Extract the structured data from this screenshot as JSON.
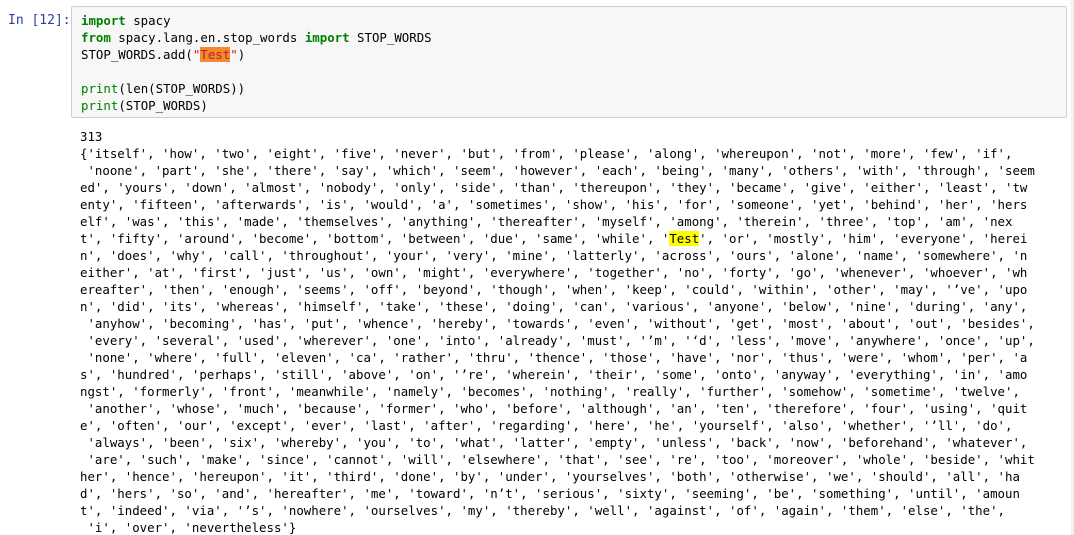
{
  "cell": {
    "prompt": "In [12]:",
    "code": {
      "line1": {
        "kw": "import",
        "rest": " spacy"
      },
      "line2": {
        "kw1": "from",
        "mod": " spacy.lang.en.stop_words ",
        "kw2": "import",
        "rest": " STOP_WORDS"
      },
      "line3": {
        "pre": "STOP_WORDS.add(",
        "q1": "\"",
        "hl": "Test",
        "q2": "\"",
        "post": ")"
      },
      "line5": {
        "fn": "print",
        "rest": "(len(STOP_WORDS))"
      },
      "line6": {
        "fn": "print",
        "rest": "(STOP_WORDS)"
      }
    }
  },
  "output": {
    "count": "313",
    "lines": [
      "{'itself', 'how', 'two', 'eight', 'five', 'never', 'but', 'from', 'please', 'along', 'whereupon', 'not', 'more', 'few', 'if',",
      " 'noone', 'part', 'she', 'there', 'say', 'which', 'seem', 'however', 'each', 'being', 'many', 'others', 'with', 'through', 'seem",
      "ed', 'yours', 'down', 'almost', 'nobody', 'only', 'side', 'than', 'thereupon', 'they', 'became', 'give', 'either', 'least', 'tw",
      "enty', 'fifteen', 'afterwards', 'is', 'would', 'a', 'sometimes', 'show', 'his', 'for', 'someone', 'yet', 'behind', 'her', 'hers",
      "elf', 'was', 'this', 'made', 'themselves', 'anything', 'thereafter', 'myself', 'among', 'therein', 'three', 'top', 'am', 'nex",
      {
        "before": "t', 'fifty', 'around', 'become', 'bottom', 'between', 'due', 'same', 'while', '",
        "highlight": "Test",
        "after": "', 'or', 'mostly', 'him', 'everyone', 'herei"
      },
      "n', 'does', 'why', 'call', 'throughout', 'your', 'very', 'mine', 'latterly', 'across', 'ours', 'alone', 'name', 'somewhere', 'n",
      "either', 'at', 'first', 'just', 'us', 'own', 'might', 'everywhere', 'together', 'no', 'forty', 'go', 'whenever', 'whoever', 'wh",
      "ereafter', 'then', 'enough', 'seems', 'off', 'beyond', 'though', 'when', 'keep', 'could', 'within', 'other', 'may', '’ve', 'upo",
      "n', 'did', 'its', 'whereas', 'himself', 'take', 'these', 'doing', 'can', 'various', 'anyone', 'below', 'nine', 'during', 'any',",
      " 'anyhow', 'becoming', 'has', 'put', 'whence', 'hereby', 'towards', 'even', 'without', 'get', 'most', 'about', 'out', 'besides',",
      " 'every', 'several', 'used', 'wherever', 'one', 'into', 'already', 'must', '’m', '‘d', 'less', 'move', 'anywhere', 'once', 'up',",
      " 'none', 'where', 'full', 'eleven', 'ca', 'rather', 'thru', 'thence', 'those', 'have', 'nor', 'thus', 'were', 'whom', 'per', 'a",
      "s', 'hundred', 'perhaps', 'still', 'above', 'on', '’re', 'wherein', 'their', 'some', 'onto', 'anyway', 'everything', 'in', 'amo",
      "ngst', 'formerly', 'front', 'meanwhile', 'namely', 'becomes', 'nothing', 'really', 'further', 'somehow', 'sometime', 'twelve',",
      " 'another', 'whose', 'much', 'because', 'former', 'who', 'before', 'although', 'an', 'ten', 'therefore', 'four', 'using', 'quit",
      "e', 'often', 'our', 'except', 'ever', 'last', 'after', 'regarding', 'here', 'he', 'yourself', 'also', 'whether', '’ll', 'do',",
      " 'always', 'been', 'six', 'whereby', 'you', 'to', 'what', 'latter', 'empty', 'unless', 'back', 'now', 'beforehand', 'whatever',",
      " 'are', 'such', 'make', 'since', 'cannot', 'will', 'elsewhere', 'that', 'see', 're', 'too', 'moreover', 'whole', 'beside', 'whit",
      "her', 'hence', 'hereupon', 'it', 'third', 'done', 'by', 'under', 'yourselves', 'both', 'otherwise', 'we', 'should', 'all', 'ha",
      "d', 'hers', 'so', 'and', 'hereafter', 'me', 'toward', 'n’t', 'serious', 'sixty', 'seeming', 'be', 'something', 'until', 'amoun",
      "t', 'indeed', 'via', '’s', 'nowhere', 'ourselves', 'my', 'thereby', 'well', 'against', 'of', 'again', 'them', 'else', 'the',",
      " 'i', 'over', 'nevertheless'}"
    ]
  }
}
